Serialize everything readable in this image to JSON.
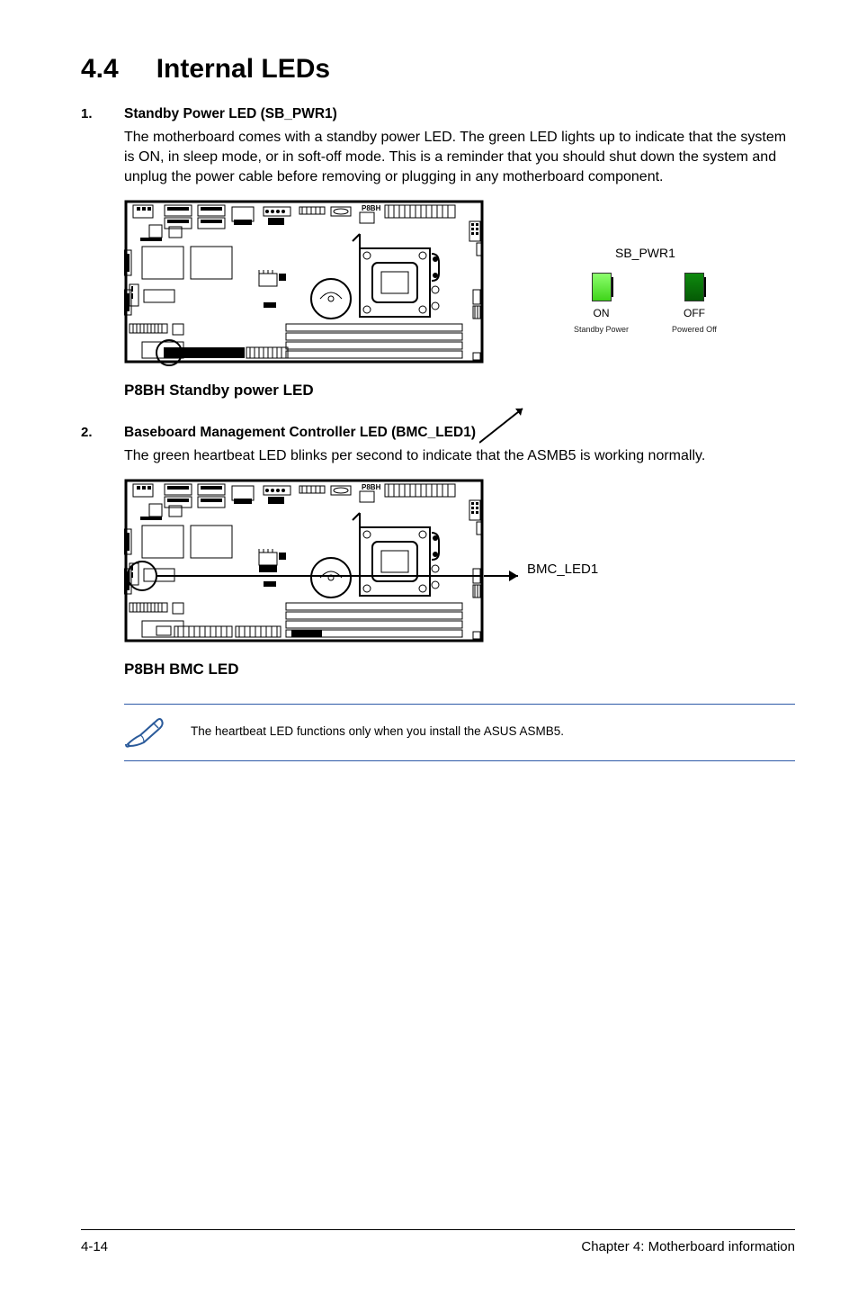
{
  "heading": {
    "number": "4.4",
    "title": "Internal LEDs"
  },
  "items": [
    {
      "num": "1.",
      "title": "Standby Power LED (SB_PWR1)",
      "body": "The motherboard comes with a standby power LED. The green LED lights up to indicate that the system is ON, in sleep mode, or in soft-off mode. This is a reminder that you should shut down the system and unplug the power cable before removing or plugging in any motherboard component.",
      "figure": {
        "caption": "P8BH Standby power LED",
        "text_on_board": "P8BH",
        "legend": {
          "title": "SB_PWR1",
          "on": {
            "state": "ON",
            "sub": "Standby Power"
          },
          "off": {
            "state": "OFF",
            "sub": "Powered Off"
          }
        }
      }
    },
    {
      "num": "2.",
      "title": "Baseboard Management Controller LED (BMC_LED1)",
      "body": "The green heartbeat LED blinks per second to indicate that the ASMB5 is working normally.",
      "figure": {
        "caption": "P8BH BMC LED",
        "text_on_board": "P8BH",
        "pointer_label": "BMC_LED1"
      }
    }
  ],
  "note": "The heartbeat LED functions only when you install the ASUS ASMB5.",
  "footer": {
    "left": "4-14",
    "right": "Chapter 4: Motherboard information"
  }
}
